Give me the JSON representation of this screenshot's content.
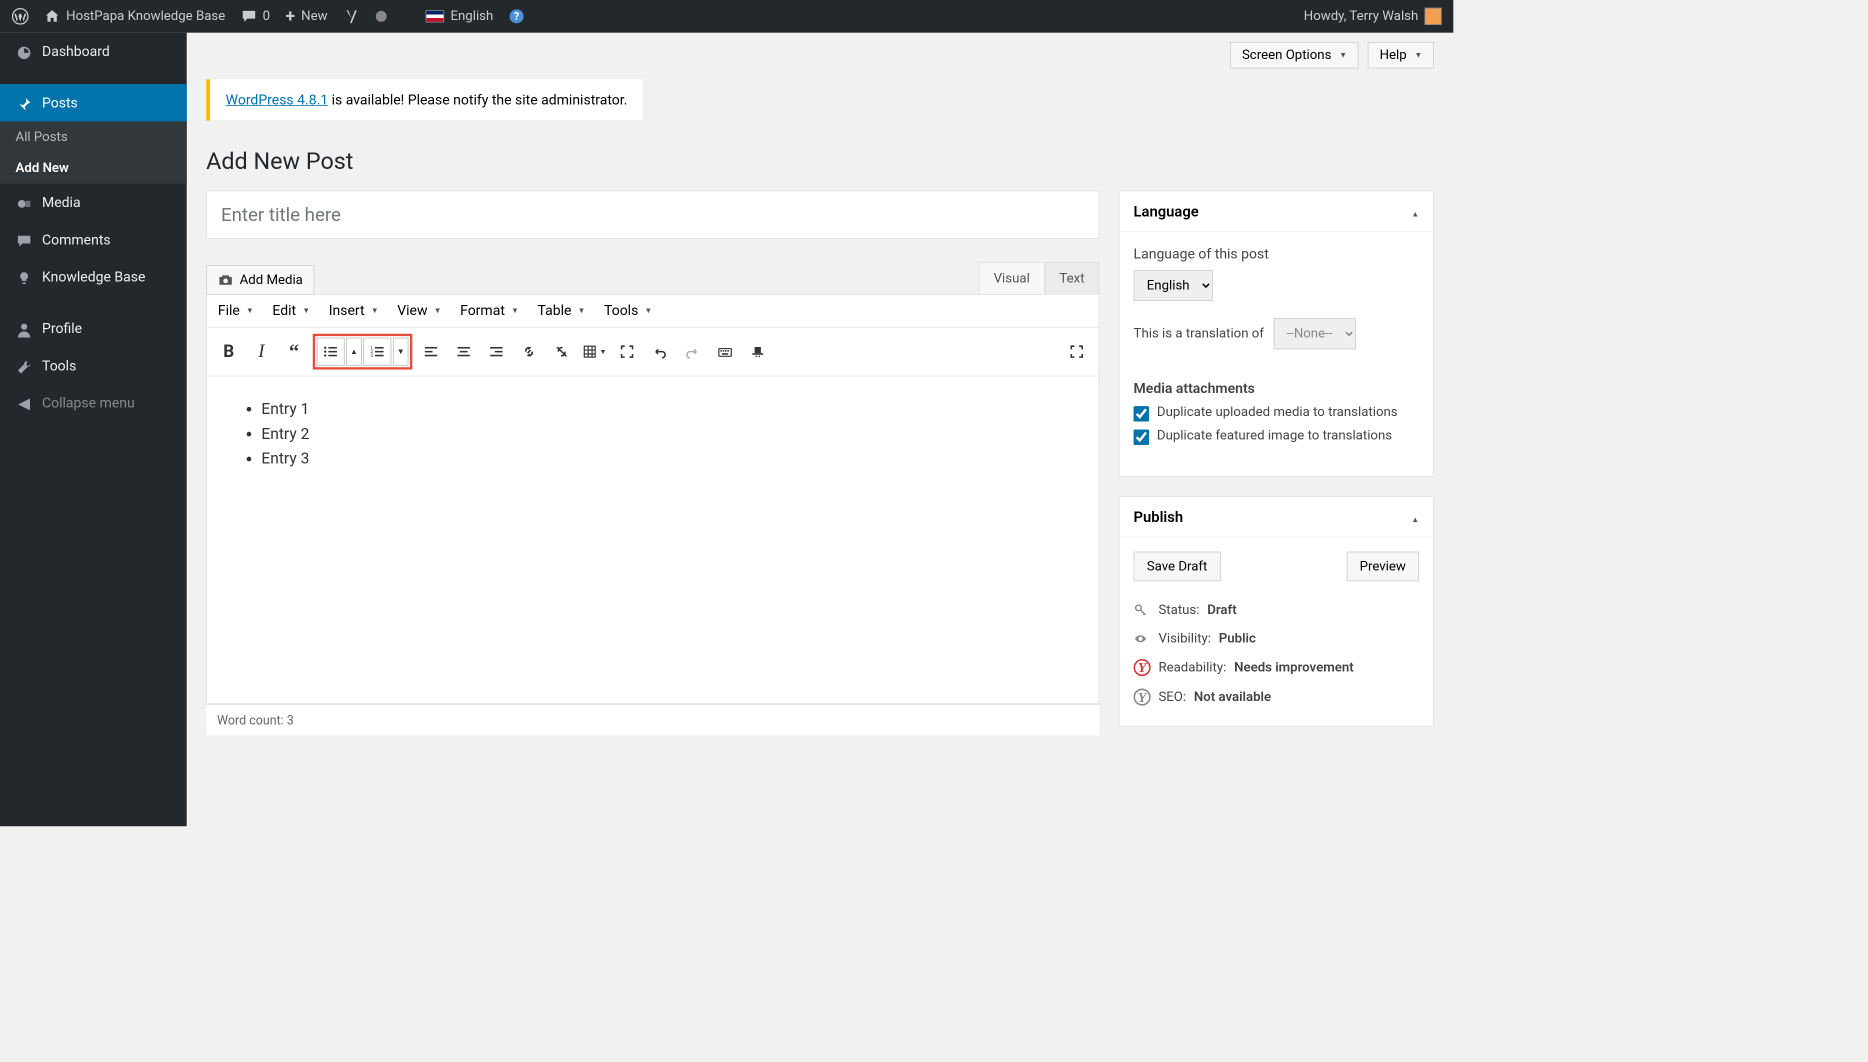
{
  "topbar": {
    "site_name": "HostPapa Knowledge Base",
    "comments_count": "0",
    "new_label": "New",
    "language": "English",
    "howdy": "Howdy, Terry Walsh"
  },
  "sidebar": {
    "dashboard": "Dashboard",
    "posts": "Posts",
    "all_posts": "All Posts",
    "add_new": "Add New",
    "media": "Media",
    "comments": "Comments",
    "kb": "Knowledge Base",
    "profile": "Profile",
    "tools": "Tools",
    "collapse": "Collapse menu"
  },
  "screen_options": "Screen Options",
  "help": "Help",
  "notice": {
    "link": "WordPress 4.8.1",
    "text": " is available! Please notify the site administrator."
  },
  "page_title": "Add New Post",
  "title_placeholder": "Enter title here",
  "add_media": "Add Media",
  "tabs": {
    "visual": "Visual",
    "text": "Text"
  },
  "menubar": {
    "file": "File",
    "edit": "Edit",
    "insert": "Insert",
    "view": "View",
    "format": "Format",
    "table": "Table",
    "tools": "Tools"
  },
  "content_items": [
    "Entry 1",
    "Entry 2",
    "Entry 3"
  ],
  "word_count_label": "Word count: ",
  "word_count": "3",
  "language_box": {
    "title": "Language",
    "post_lang_label": "Language of this post",
    "selected_lang": "English",
    "translation_of": "This is a translation of",
    "translation_none": "--None--",
    "attachments_heading": "Media attachments",
    "dup_media": "Duplicate uploaded media to translations",
    "dup_featured": "Duplicate featured image to translations"
  },
  "publish_box": {
    "title": "Publish",
    "save_draft": "Save Draft",
    "preview": "Preview",
    "status_label": "Status: ",
    "status_value": "Draft",
    "visibility_label": "Visibility: ",
    "visibility_value": "Public",
    "readability_label": "Readability: ",
    "readability_value": "Needs improvement",
    "seo_label": "SEO: ",
    "seo_value": "Not available"
  }
}
